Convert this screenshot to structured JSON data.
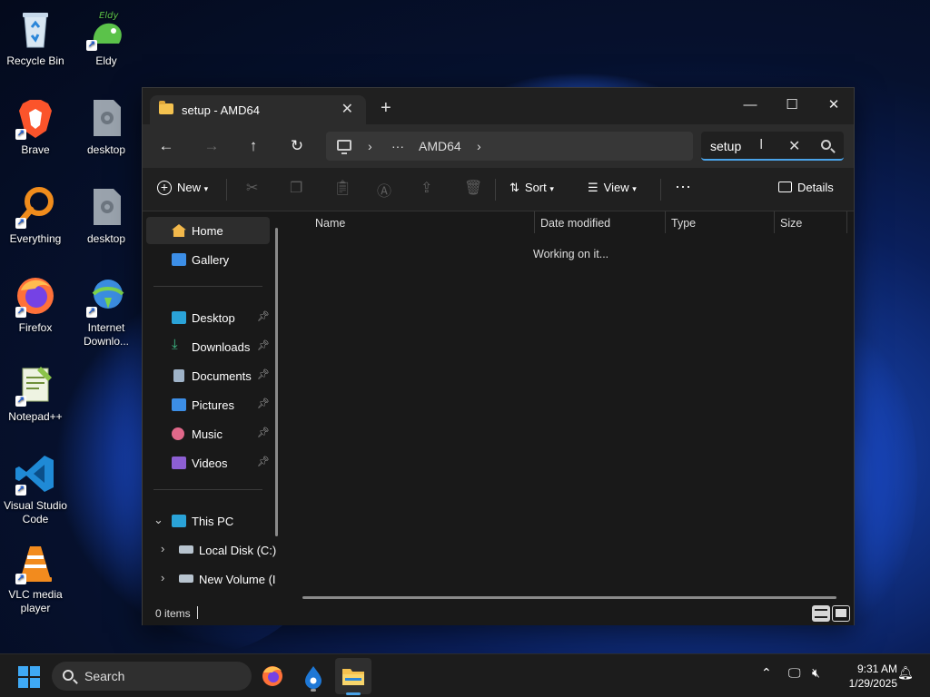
{
  "desktop": {
    "icons": [
      {
        "label": "Recycle Bin"
      },
      {
        "label": "Eldy",
        "badge": "Eldy"
      },
      {
        "label": "Brave"
      },
      {
        "label": "desktop"
      },
      {
        "label": "Everything"
      },
      {
        "label": "desktop"
      },
      {
        "label": "Firefox"
      },
      {
        "label": "Internet Downlo..."
      },
      {
        "label": "Notepad++"
      },
      {
        "label": "Visual Studio Code"
      },
      {
        "label": "VLC media player"
      }
    ]
  },
  "explorer": {
    "tab_title": "setup - AMD64",
    "address": {
      "ellipsis": "···",
      "crumb": "AMD64"
    },
    "search_value": "setup",
    "toolbar": {
      "new_label": "New",
      "sort_label": "Sort",
      "view_label": "View",
      "more_label": "···",
      "details_label": "Details"
    },
    "sidebar": {
      "home": "Home",
      "gallery": "Gallery",
      "desktop": "Desktop",
      "downloads": "Downloads",
      "documents": "Documents",
      "pictures": "Pictures",
      "music": "Music",
      "videos": "Videos",
      "this_pc": "This PC",
      "local_disk": "Local Disk (C:)",
      "new_volume": "New Volume (I"
    },
    "columns": {
      "name": "Name",
      "date_modified": "Date modified",
      "type": "Type",
      "size": "Size"
    },
    "working_text": "Working on it...",
    "status_text": "0 items"
  },
  "taskbar": {
    "search_label": "Search",
    "time": "9:31 AM",
    "date": "1/29/2025"
  },
  "colors": {
    "accent": "#4aa3e8",
    "start_blue": "#3fa9f5",
    "folder_yellow": "#f4c24f"
  }
}
